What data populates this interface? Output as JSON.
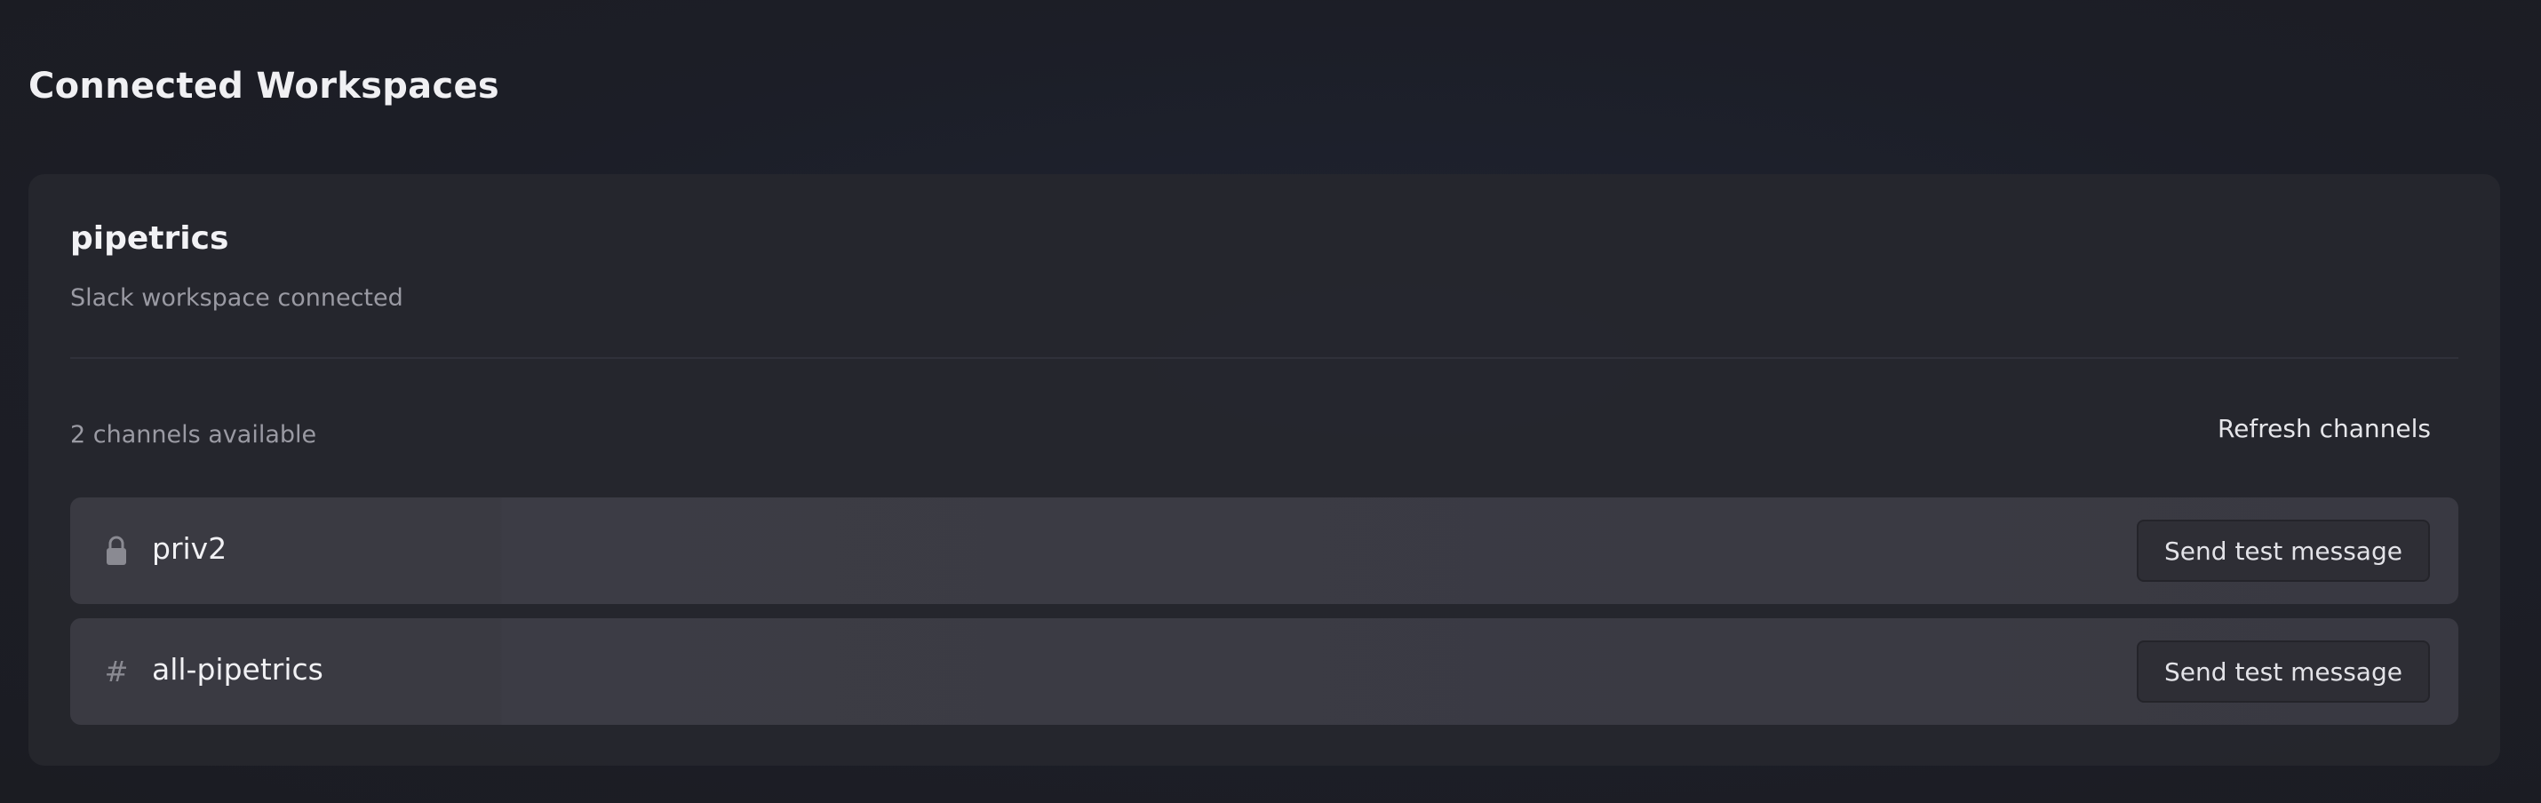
{
  "page": {
    "title": "Connected Workspaces"
  },
  "workspace": {
    "name": "pipetrics",
    "subtitle": "Slack workspace connected",
    "channels_count_text": "2 channels available",
    "refresh_label": "Refresh channels",
    "channels": [
      {
        "name": "priv2",
        "icon": "lock-icon",
        "action_label": "Send test message"
      },
      {
        "name": "all-pipetrics",
        "icon": "hash-icon",
        "icon_glyph": "#",
        "action_label": "Send test message"
      }
    ]
  },
  "colors": {
    "background": "#1d1f27",
    "card": "#26272e",
    "row": "#3a3a42",
    "muted_text": "#9a9aa3"
  }
}
